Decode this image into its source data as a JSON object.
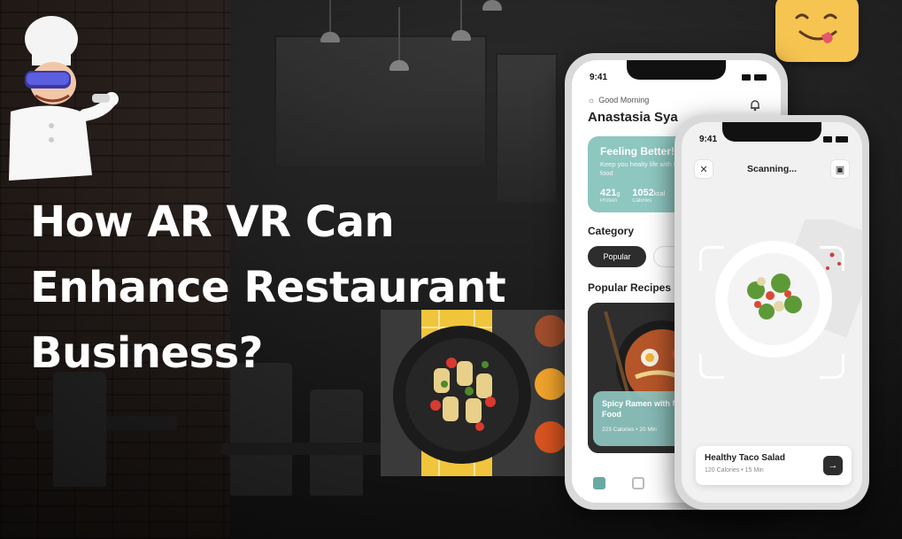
{
  "headline": {
    "line1": "How AR VR Can",
    "line2": "Enhance Restaurant",
    "line3": "Business?"
  },
  "app_home": {
    "time": "9:41",
    "greeting": "Good Morning",
    "user_name": "Anastasia Sya",
    "feeling_card": {
      "title": "Feeling Better!",
      "subtitle": "Keep you healty life with healthy food",
      "protein_value": "421",
      "protein_unit": "g",
      "protein_label": "Protein",
      "calories_value": "1052",
      "calories_unit": "kcal",
      "calories_label": "Calories"
    },
    "category_title": "Category",
    "category_selected": "Popular",
    "popular_title": "Popular Recipes",
    "recipe": {
      "name": "Spicy Ramen with Mixing Sea Food",
      "calories": "223 Calories",
      "time": "20 Min"
    }
  },
  "app_scan": {
    "time": "9:41",
    "title": "Scanning...",
    "result_name": "Healthy Taco Salad",
    "result_calories": "120 Calories",
    "result_time": "15 Min"
  },
  "icons": [
    "chef-mascot-icon",
    "emoji-tongue-icon",
    "sun-icon",
    "bell-icon",
    "close-icon",
    "gallery-icon",
    "arrow-right-icon",
    "home-tab-icon",
    "chart-tab-icon",
    "scan-fab-icon"
  ],
  "colors": {
    "accent": "#8ec6c0",
    "dark": "#2d2d2d",
    "headline": "#ffffff"
  }
}
